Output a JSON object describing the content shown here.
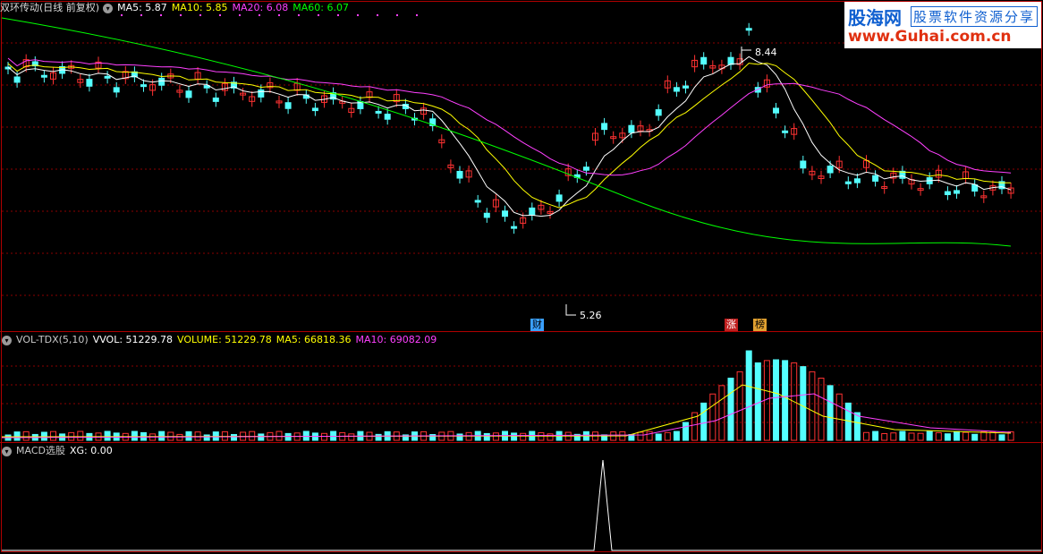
{
  "main_header": {
    "title": "双环传动(日线 前复权)",
    "ma5": "MA5: 5.87",
    "ma10": "MA10: 5.85",
    "ma20": "MA20: 6.08",
    "ma60": "MA60: 6.07"
  },
  "vol_header": {
    "name": "VOL-TDX(5,10)",
    "vvol": "VVOL: 51229.78",
    "volume": "VOLUME: 51229.78",
    "ma5": "MA5: 66818.36",
    "ma10": "MA10: 69082.09"
  },
  "macd_header": {
    "name": "MACD选股",
    "xg": "XG: 0.00"
  },
  "watermark": {
    "brand": "股海网",
    "slogan": "股票软件资源分享",
    "url": "www.Guhai.com.cn"
  },
  "annotations": {
    "high_price": "8.44",
    "low_price": "5.26",
    "tag_cai": "财",
    "tag_zhang": "涨",
    "tag_bang": "榜"
  },
  "colors": {
    "up": "#ff3232",
    "down": "#54ffff",
    "ma5": "#ffffff",
    "ma10": "#ffff00",
    "ma20": "#ff40ff",
    "ma60": "#00ff00",
    "grid": "#8b0000",
    "border": "#b00000"
  }
}
